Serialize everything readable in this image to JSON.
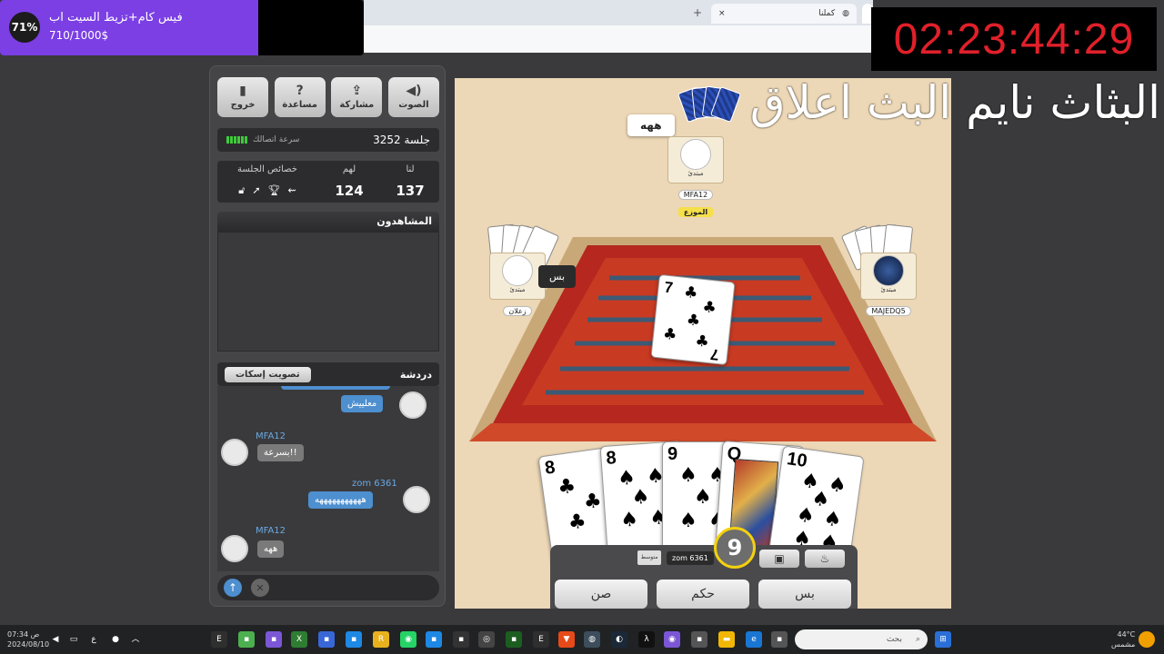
{
  "browser": {
    "tab_title": "كملنا",
    "new_tab": "+"
  },
  "stream": {
    "goal_percent": "71%",
    "goal_progress": 0.71,
    "goal_title": "فيس كام+تزيط السيت اب",
    "goal_amount": "710/1000$",
    "timer": "02:23:44:29",
    "message": "البثاث نايم البث اعلاق"
  },
  "panel": {
    "buttons": [
      {
        "label": "الصوت",
        "icon": "speaker-icon"
      },
      {
        "label": "مشاركة",
        "icon": "share-icon"
      },
      {
        "label": "مساعدة",
        "icon": "help-icon"
      },
      {
        "label": "خروج",
        "icon": "exit-icon"
      }
    ],
    "session": "جلسة 3252",
    "connection_label": "سرعة اتصالك",
    "score_headers": {
      "us": "لنا",
      "them": "لهم",
      "props": "خصائص الجلسة"
    },
    "score_values": {
      "us": "137",
      "them": "124"
    },
    "watchers_title": "المشاهدون",
    "chat_title": "دردشة",
    "mute_vote": "تصويت إسكات"
  },
  "chat": [
    {
      "name": "",
      "text": "معلييش",
      "side": "right"
    },
    {
      "name": "MFA12",
      "text": "بسرعة!!",
      "side": "left"
    },
    {
      "name": "zom 6361",
      "text": "هههههههههههه",
      "side": "right"
    },
    {
      "name": "MFA12",
      "text": "ههه",
      "side": "left"
    }
  ],
  "game": {
    "top_player": {
      "status": "مبتدئ",
      "name": "MFA12",
      "role": "الموزع",
      "bubble": "ههه"
    },
    "left_player": {
      "status": "مبتدئ",
      "name": "زعلان",
      "bubble": "بس"
    },
    "right_player": {
      "status": "مبتدئ",
      "name": "MAJEDQ5"
    },
    "table_card": {
      "rank": "7",
      "suit": "♣"
    },
    "hand": [
      {
        "rank": "8",
        "suit": "♣"
      },
      {
        "rank": "8",
        "suit": "♠"
      },
      {
        "rank": "9",
        "suit": "♠"
      },
      {
        "rank": "Q",
        "suit": "♠"
      },
      {
        "rank": "10",
        "suit": "♠"
      }
    ],
    "self_name": "zom 6361",
    "self_level": "متوسط",
    "turn_timer": "9",
    "actions": [
      {
        "label": "صن"
      },
      {
        "label": "حكم"
      },
      {
        "label": "بس"
      }
    ]
  },
  "taskbar": {
    "search_placeholder": "بحث",
    "weather_temp": "44°C",
    "weather_desc": "مشمس",
    "time": "07:34 ص",
    "date": "2024/08/10",
    "lang": "ع"
  }
}
